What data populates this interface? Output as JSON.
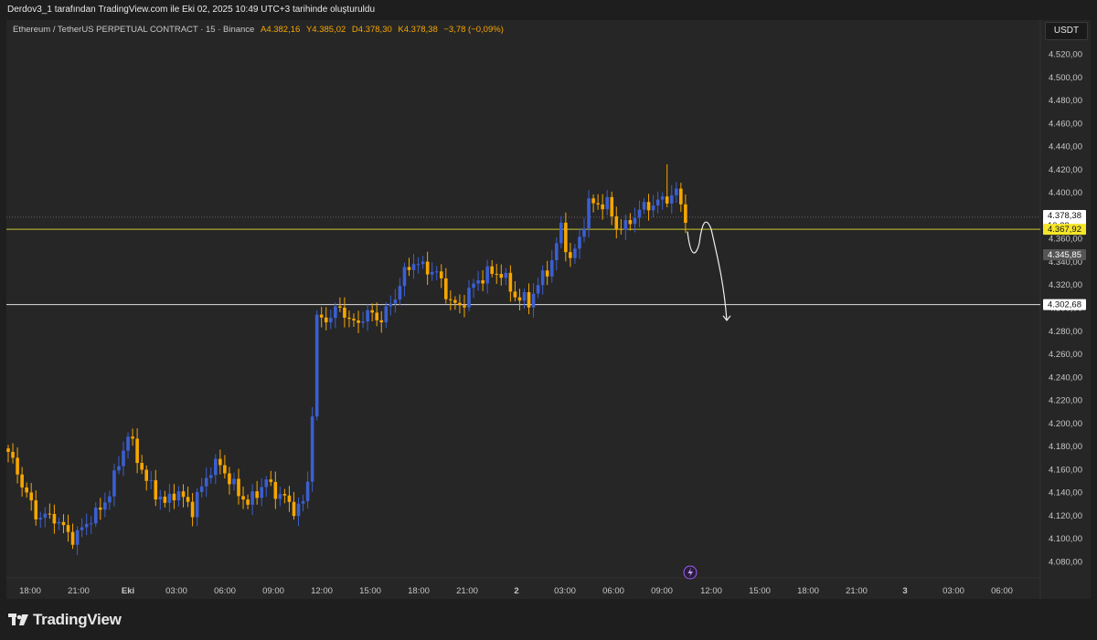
{
  "header": {
    "attribution": "Derdov3_1 tarafından TradingView.com ile Eki 02, 2025 10:49 UTC+3 tarihinde oluşturuldu"
  },
  "legend": {
    "symbol": "Ethereum / TetherUS PERPETUAL CONTRACT · 15 · Binance",
    "open": "A4.382,16",
    "high": "Y4.385,02",
    "low": "D4.378,30",
    "close": "K4.378,38",
    "change": "−3,78 (−0,09%)"
  },
  "currency": "USDT",
  "brand": "TradingView",
  "colors": {
    "up": "#3b5fd0",
    "down": "#f7a600",
    "line_yellow": "#c8c832",
    "line_white": "#e0e0e0",
    "background": "#262626"
  },
  "chart_data": {
    "type": "candlestick",
    "y_ticks": [
      "4.520,00",
      "4.500,00",
      "4.480,00",
      "4.460,00",
      "4.440,00",
      "4.420,00",
      "4.400,00",
      "4.380,00",
      "4.360,00",
      "4.340,00",
      "4.320,00",
      "4.300,00",
      "4.280,00",
      "4.260,00",
      "4.240,00",
      "4.220,00",
      "4.200,00",
      "4.180,00",
      "4.160,00",
      "4.140,00",
      "4.120,00",
      "4.100,00",
      "4.080,00"
    ],
    "x_ticks": [
      "18:00",
      "21:00",
      "Eki",
      "03:00",
      "06:00",
      "09:00",
      "12:00",
      "15:00",
      "18:00",
      "21:00",
      "2",
      "03:00",
      "06:00",
      "09:00",
      "12:00",
      "15:00",
      "18:00",
      "21:00",
      "3",
      "03:00",
      "06:00"
    ],
    "ylim": [
      4073,
      4533
    ],
    "price_labels": [
      {
        "name": "last",
        "text": "4.378,38",
        "sub": "10:29",
        "value": 4378.38
      },
      {
        "name": "line-high",
        "text": "4.367,92",
        "value": 4367.92
      },
      {
        "name": "mid",
        "text": "4.345,85",
        "value": 4345.85
      },
      {
        "name": "line-low",
        "text": "4.302,68",
        "value": 4302.68
      }
    ],
    "horizontal_lines": [
      4367.92,
      4302.68
    ],
    "projection": [
      4366,
      4352,
      4366,
      4320,
      4289
    ],
    "anchors": [
      [
        0,
        4175
      ],
      [
        6,
        4120
      ],
      [
        10,
        4118
      ],
      [
        14,
        4100
      ],
      [
        16,
        4108
      ],
      [
        18,
        4118
      ],
      [
        20,
        4125
      ],
      [
        22,
        4140
      ],
      [
        24,
        4165
      ],
      [
        26,
        4190
      ],
      [
        28,
        4170
      ],
      [
        30,
        4150
      ],
      [
        32,
        4140
      ],
      [
        34,
        4130
      ],
      [
        36,
        4140
      ],
      [
        38,
        4135
      ],
      [
        40,
        4125
      ],
      [
        42,
        4145
      ],
      [
        44,
        4160
      ],
      [
        46,
        4165
      ],
      [
        48,
        4150
      ],
      [
        50,
        4140
      ],
      [
        52,
        4130
      ],
      [
        54,
        4140
      ],
      [
        56,
        4150
      ],
      [
        58,
        4140
      ],
      [
        60,
        4135
      ],
      [
        62,
        4125
      ],
      [
        64,
        4130
      ],
      [
        65,
        4150
      ],
      [
        66,
        4210
      ],
      [
        67,
        4290
      ],
      [
        69,
        4290
      ],
      [
        72,
        4300
      ],
      [
        75,
        4285
      ],
      [
        78,
        4295
      ],
      [
        81,
        4290
      ],
      [
        84,
        4310
      ],
      [
        86,
        4330
      ],
      [
        88,
        4340
      ],
      [
        90,
        4335
      ],
      [
        93,
        4330
      ],
      [
        96,
        4305
      ],
      [
        98,
        4300
      ],
      [
        101,
        4320
      ],
      [
        104,
        4330
      ],
      [
        107,
        4330
      ],
      [
        110,
        4310
      ],
      [
        113,
        4305
      ],
      [
        115,
        4320
      ],
      [
        118,
        4340
      ],
      [
        120,
        4370
      ],
      [
        122,
        4340
      ],
      [
        124,
        4360
      ],
      [
        126,
        4390
      ],
      [
        130,
        4390
      ],
      [
        132,
        4370
      ],
      [
        134,
        4370
      ],
      [
        137,
        4385
      ],
      [
        140,
        4390
      ],
      [
        143,
        4395
      ],
      [
        145,
        4400
      ],
      [
        147,
        4378
      ]
    ]
  }
}
